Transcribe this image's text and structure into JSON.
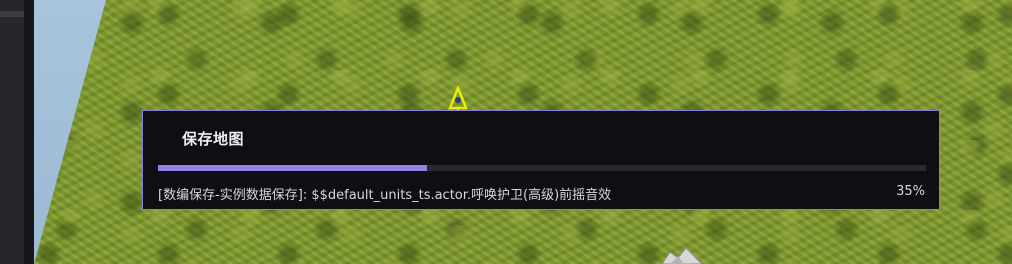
{
  "dialog": {
    "title": "保存地图",
    "status": "[数编保存-实例数据保存]: $$default_units_ts.actor.呼唤护卫(高级)前摇音效",
    "progress_percent": 35,
    "progress_label": "35%",
    "accent_color": "#8f84e6"
  },
  "viewport": {
    "terrain": "grass",
    "icons": [
      "unit-marker-icon",
      "prop-icon"
    ]
  }
}
